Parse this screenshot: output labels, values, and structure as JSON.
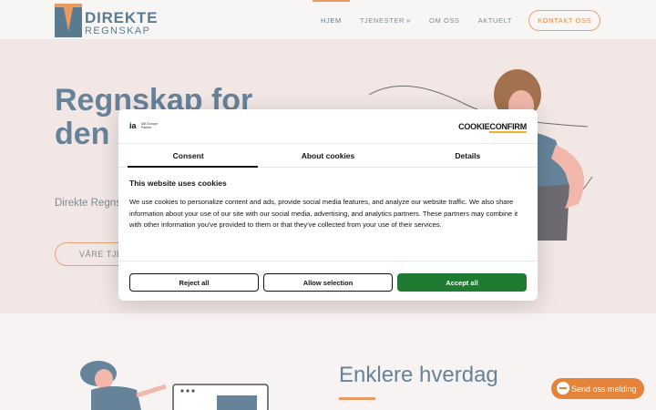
{
  "header": {
    "logo_line1": "DIREKTE",
    "logo_line2": "REGNSKAP",
    "nav": [
      {
        "label": "HJEM"
      },
      {
        "label": "TJENESTER"
      },
      {
        "label": "OM OSS"
      },
      {
        "label": "AKTUELT"
      }
    ],
    "cta": "KONTAKT OSS"
  },
  "hero": {
    "title": "Regnskap for den økon",
    "text": "Direkte Regns skapt for det c",
    "button": "VÅRE TJE"
  },
  "section2": {
    "title": "Enklere hverdag"
  },
  "chat_button": "Send oss melding",
  "cookie_dialog": {
    "left_logo": "ia",
    "left_logo_sub": "IAB Europe Partner",
    "right_logo_a": "C",
    "right_logo_b": "OOKIE",
    "right_logo_c": "CONFIRM",
    "tabs": [
      {
        "label": "Consent"
      },
      {
        "label": "About cookies"
      },
      {
        "label": "Details"
      }
    ],
    "heading": "This website uses cookies",
    "text": "We use cookies to personalize content and ads, provide social media features, and analyze our website traffic. We also share information about your use of our site with our social media, advertising, and analytics partners. These partners may combine it with other information you've provided to them or that they've collected from your use of their services.",
    "buttons": {
      "reject": "Reject all",
      "allow": "Allow selection",
      "accept": "Accept all"
    }
  },
  "colors": {
    "brand_blue": "#5c7a8f",
    "accent_orange": "#e99a5d",
    "accept_green": "#1f7a32"
  }
}
